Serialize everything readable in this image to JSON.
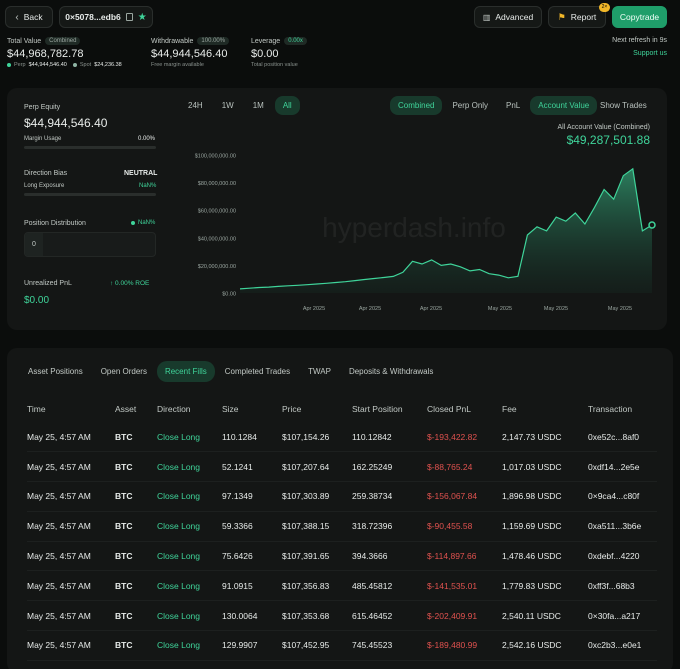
{
  "header": {
    "back_label": "Back",
    "address": "0×5078...edb6",
    "advanced_label": "Advanced",
    "report_label": "Report",
    "report_badge": "2×",
    "copytrade_label": "Copytrade",
    "refresh_text": "Next refresh in 9s",
    "support_label": "Support us"
  },
  "stats": {
    "total_value_label": "Total Value",
    "combined_chip": "Combined",
    "total_value": "$44,968,782.78",
    "perp_label": "Perp",
    "perp_value": "$44,944,546.40",
    "spot_label": "Spot",
    "spot_value": "$24,236.38",
    "withdrawable_label": "Withdrawable",
    "withdrawable_pct": "100.00%",
    "withdrawable_value": "$44,944,546.40",
    "withdrawable_sub": "Free margin available",
    "leverage_label": "Leverage",
    "leverage_chip": "0.00x",
    "leverage_value": "$0.00",
    "leverage_sub": "Total position value"
  },
  "left_panel": {
    "perp_equity_label": "Perp Equity",
    "perp_equity_value": "$44,944,546.40",
    "margin_usage_label": "Margin Usage",
    "margin_usage_value": "0.00%",
    "direction_bias_label": "Direction Bias",
    "direction_bias_value": "NEUTRAL",
    "long_exposure_label": "Long Exposure",
    "long_exposure_value": "NaN%",
    "position_dist_label": "Position Distribution",
    "position_dist_value": "NaN%",
    "position_dist_count": "0",
    "upnl_label": "Unrealized PnL",
    "upnl_roe": "↑ 0.00% ROE",
    "upnl_value": "$0.00"
  },
  "chart_controls": {
    "ranges": [
      "24H",
      "1W",
      "1M",
      "All"
    ],
    "active_range": 3,
    "combined_label": "Combined",
    "perp_only_label": "Perp Only",
    "pnl_label": "PnL",
    "account_value_label": "Account Value",
    "show_trades_label": "Show Trades",
    "chart_title": "All Account Value (Combined)",
    "chart_value": "$49,287,501.88",
    "watermark": "hyperdash.info"
  },
  "chart_data": {
    "type": "area",
    "y_ticks": [
      "$100,000,000.00",
      "$80,000,000.00",
      "$60,000,000.00",
      "$40,000,000.00",
      "$20,000,000.00",
      "$0.00"
    ],
    "x_ticks": [
      "Apr 2025",
      "Apr 2025",
      "Apr 2025",
      "May 2025",
      "May 2025",
      "May 2025"
    ],
    "ylim": [
      0,
      100000000
    ],
    "y": [
      3000000,
      3500000,
      4000000,
      4300000,
      4800000,
      5200000,
      5600000,
      6000000,
      6500000,
      7000000,
      7600000,
      8200000,
      9000000,
      9800000,
      10500000,
      11200000,
      12000000,
      15000000,
      23000000,
      21000000,
      24000000,
      20000000,
      21000000,
      19000000,
      16000000,
      17000000,
      14000000,
      13000000,
      11000000,
      12000000,
      42000000,
      48000000,
      45000000,
      55000000,
      52000000,
      58000000,
      50000000,
      62000000,
      75000000,
      68000000,
      85000000,
      90000000,
      45000000,
      49287501
    ]
  },
  "tabs": {
    "items": [
      "Asset Positions",
      "Open Orders",
      "Recent Fills",
      "Completed Trades",
      "TWAP",
      "Deposits & Withdrawals"
    ],
    "active": 2
  },
  "fills_table": {
    "columns": [
      "Time",
      "Asset",
      "Direction",
      "Size",
      "Price",
      "Start Position",
      "Closed PnL",
      "Fee",
      "Transaction"
    ],
    "rows": [
      [
        "May 25, 4:57 AM",
        "BTC",
        "Close Long",
        "110.1284",
        "$107,154.26",
        "110.12842",
        "$-193,422.82",
        "2,147.73 USDC",
        "0xe52c...8af0"
      ],
      [
        "May 25, 4:57 AM",
        "BTC",
        "Close Long",
        "52.1241",
        "$107,207.64",
        "162.25249",
        "$-88,765.24",
        "1,017.03 USDC",
        "0xdf14...2e5e"
      ],
      [
        "May 25, 4:57 AM",
        "BTC",
        "Close Long",
        "97.1349",
        "$107,303.89",
        "259.38734",
        "$-156,067.84",
        "1,896.98 USDC",
        "0×9ca4...c80f"
      ],
      [
        "May 25, 4:57 AM",
        "BTC",
        "Close Long",
        "59.3366",
        "$107,388.15",
        "318.72396",
        "$-90,455.58",
        "1,159.69 USDC",
        "0xa511...3b6e"
      ],
      [
        "May 25, 4:57 AM",
        "BTC",
        "Close Long",
        "75.6426",
        "$107,391.65",
        "394.3666",
        "$-114,897.66",
        "1,478.46 USDC",
        "0xdebf...4220"
      ],
      [
        "May 25, 4:57 AM",
        "BTC",
        "Close Long",
        "91.0915",
        "$107,356.83",
        "485.45812",
        "$-141,535.01",
        "1,779.83 USDC",
        "0xff3f...68b3"
      ],
      [
        "May 25, 4:57 AM",
        "BTC",
        "Close Long",
        "130.0064",
        "$107,353.68",
        "615.46452",
        "$-202,409.91",
        "2,540.11 USDC",
        "0×30fa...a217"
      ],
      [
        "May 25, 4:57 AM",
        "BTC",
        "Close Long",
        "129.9907",
        "$107,452.95",
        "745.45523",
        "$-189,480.99",
        "2,542.16 USDC",
        "0xc2b3...e0e1"
      ]
    ]
  }
}
